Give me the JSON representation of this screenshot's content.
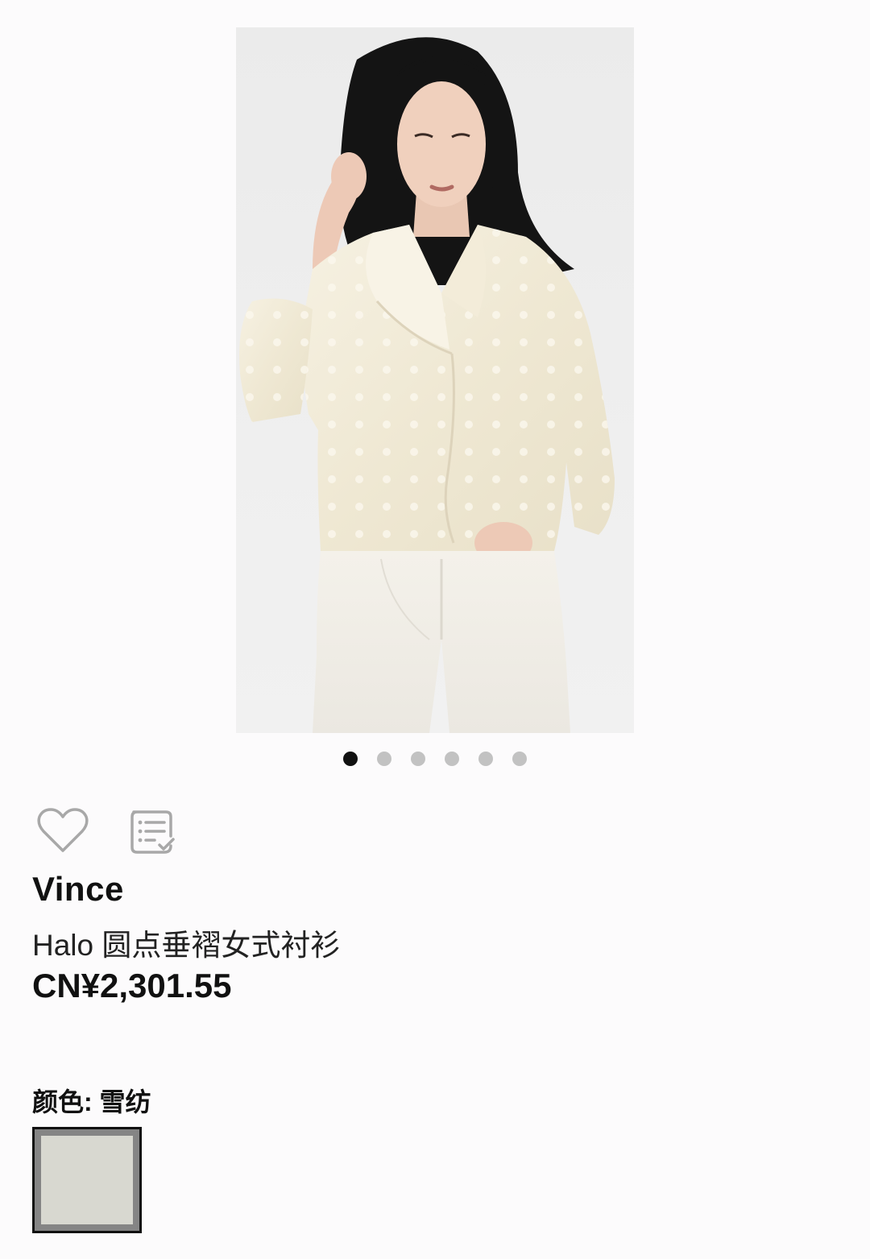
{
  "carousel": {
    "total_images": 6,
    "active_index": 0
  },
  "actions": {
    "wishlist_icon": "heart-icon",
    "notes_icon": "checklist-icon"
  },
  "product": {
    "brand": "Vince",
    "name": "Halo 圆点垂褶女式衬衫",
    "price": "CN¥2,301.55"
  },
  "color": {
    "label": "颜色: 雪纺",
    "swatch_color": "#d8d8d0"
  },
  "colors": {
    "background": "#fcfbfc",
    "text": "#111111",
    "dot_inactive": "#c2c2c2",
    "dot_active": "#111111"
  }
}
